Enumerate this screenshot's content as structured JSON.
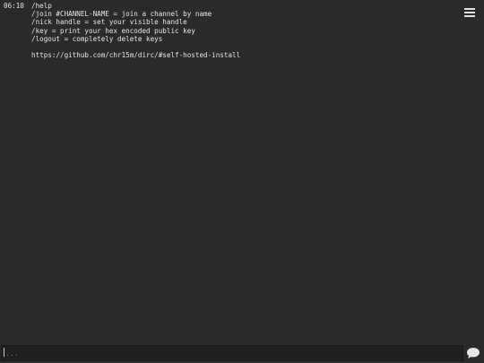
{
  "message": {
    "time": "06:10",
    "lines": [
      "/help",
      "/join #CHANNEL-NAME = join a channel by name",
      "/nick handle = set your visible handle",
      "/key = print your hex encoded public key",
      "/logout = completely delete keys",
      "",
      "https://github.com/chr15m/dirc/#self-hosted-install"
    ]
  },
  "menu": {
    "icon": "hamburger-menu-icon"
  },
  "composer": {
    "placeholder": "...",
    "send_icon": "speech-bubble-icon"
  }
}
